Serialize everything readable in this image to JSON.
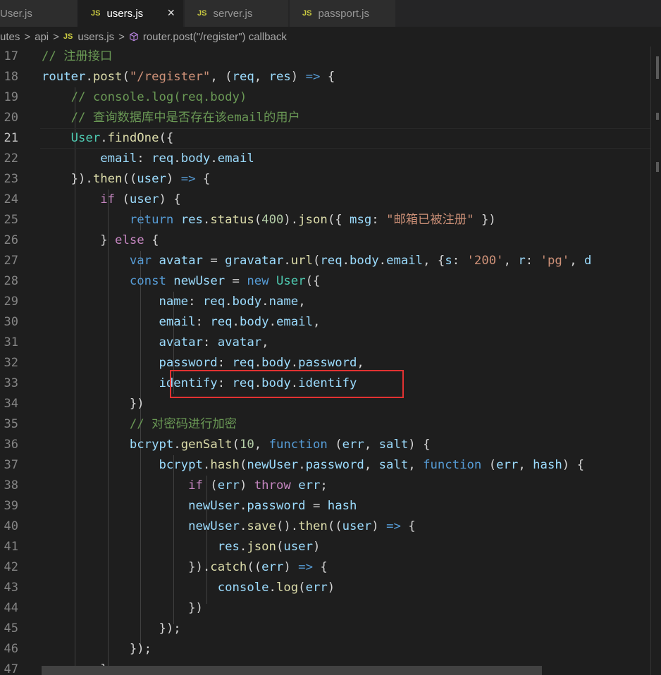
{
  "tabs": [
    {
      "label": "User.js"
    },
    {
      "label": "users.js",
      "close": "×"
    },
    {
      "label": "server.js"
    },
    {
      "label": "passport.js"
    }
  ],
  "tab_icon": "JS",
  "breadcrumb": {
    "items": [
      "utes",
      "api",
      "users.js",
      "router.post(\"/register\") callback"
    ],
    "separator": ">",
    "file_icon": "JS",
    "symbol_icon": "method-cube-icon"
  },
  "editor": {
    "current_line": "21",
    "lines": [
      {
        "n": "17",
        "code": "// 注册接口"
      },
      {
        "n": "18",
        "code": "router.post(\"/register\", (req, res) => {"
      },
      {
        "n": "19",
        "code": "    // console.log(req.body)"
      },
      {
        "n": "20",
        "code": "    // 查询数据库中是否存在该email的用户"
      },
      {
        "n": "21",
        "code": "    User.findOne({"
      },
      {
        "n": "22",
        "code": "        email: req.body.email"
      },
      {
        "n": "23",
        "code": "    }).then((user) => {"
      },
      {
        "n": "24",
        "code": "        if (user) {"
      },
      {
        "n": "25",
        "code": "            return res.status(400).json({ msg: \"邮箱已被注册\" })"
      },
      {
        "n": "26",
        "code": "        } else {"
      },
      {
        "n": "27",
        "code": "            var avatar = gravatar.url(req.body.email, {s: '200', r: 'pg', d"
      },
      {
        "n": "28",
        "code": "            const newUser = new User({"
      },
      {
        "n": "29",
        "code": "                name: req.body.name,"
      },
      {
        "n": "30",
        "code": "                email: req.body.email,"
      },
      {
        "n": "31",
        "code": "                avatar: avatar,"
      },
      {
        "n": "32",
        "code": "                password: req.body.password,"
      },
      {
        "n": "33",
        "code": "                identify: req.body.identify"
      },
      {
        "n": "34",
        "code": "            })"
      },
      {
        "n": "35",
        "code": "            // 对密码进行加密"
      },
      {
        "n": "36",
        "code": "            bcrypt.genSalt(10, function (err, salt) {"
      },
      {
        "n": "37",
        "code": "                bcrypt.hash(newUser.password, salt, function (err, hash) {"
      },
      {
        "n": "38",
        "code": "                    if (err) throw err;"
      },
      {
        "n": "39",
        "code": "                    newUser.password = hash"
      },
      {
        "n": "40",
        "code": "                    newUser.save().then((user) => {"
      },
      {
        "n": "41",
        "code": "                        res.json(user)"
      },
      {
        "n": "42",
        "code": "                    }).catch((err) => {"
      },
      {
        "n": "43",
        "code": "                        console.log(err)"
      },
      {
        "n": "44",
        "code": "                    })"
      },
      {
        "n": "45",
        "code": "                });"
      },
      {
        "n": "46",
        "code": "            });"
      },
      {
        "n": "47",
        "code": "        }"
      }
    ]
  },
  "highlighted_line": "33",
  "colors": {
    "background": "#1e1e1e",
    "highlight_box": "#e23232",
    "keyword": "#569cd6",
    "control": "#c586c0",
    "function": "#dcdcaa",
    "string": "#ce9178",
    "comment": "#6a9955"
  }
}
